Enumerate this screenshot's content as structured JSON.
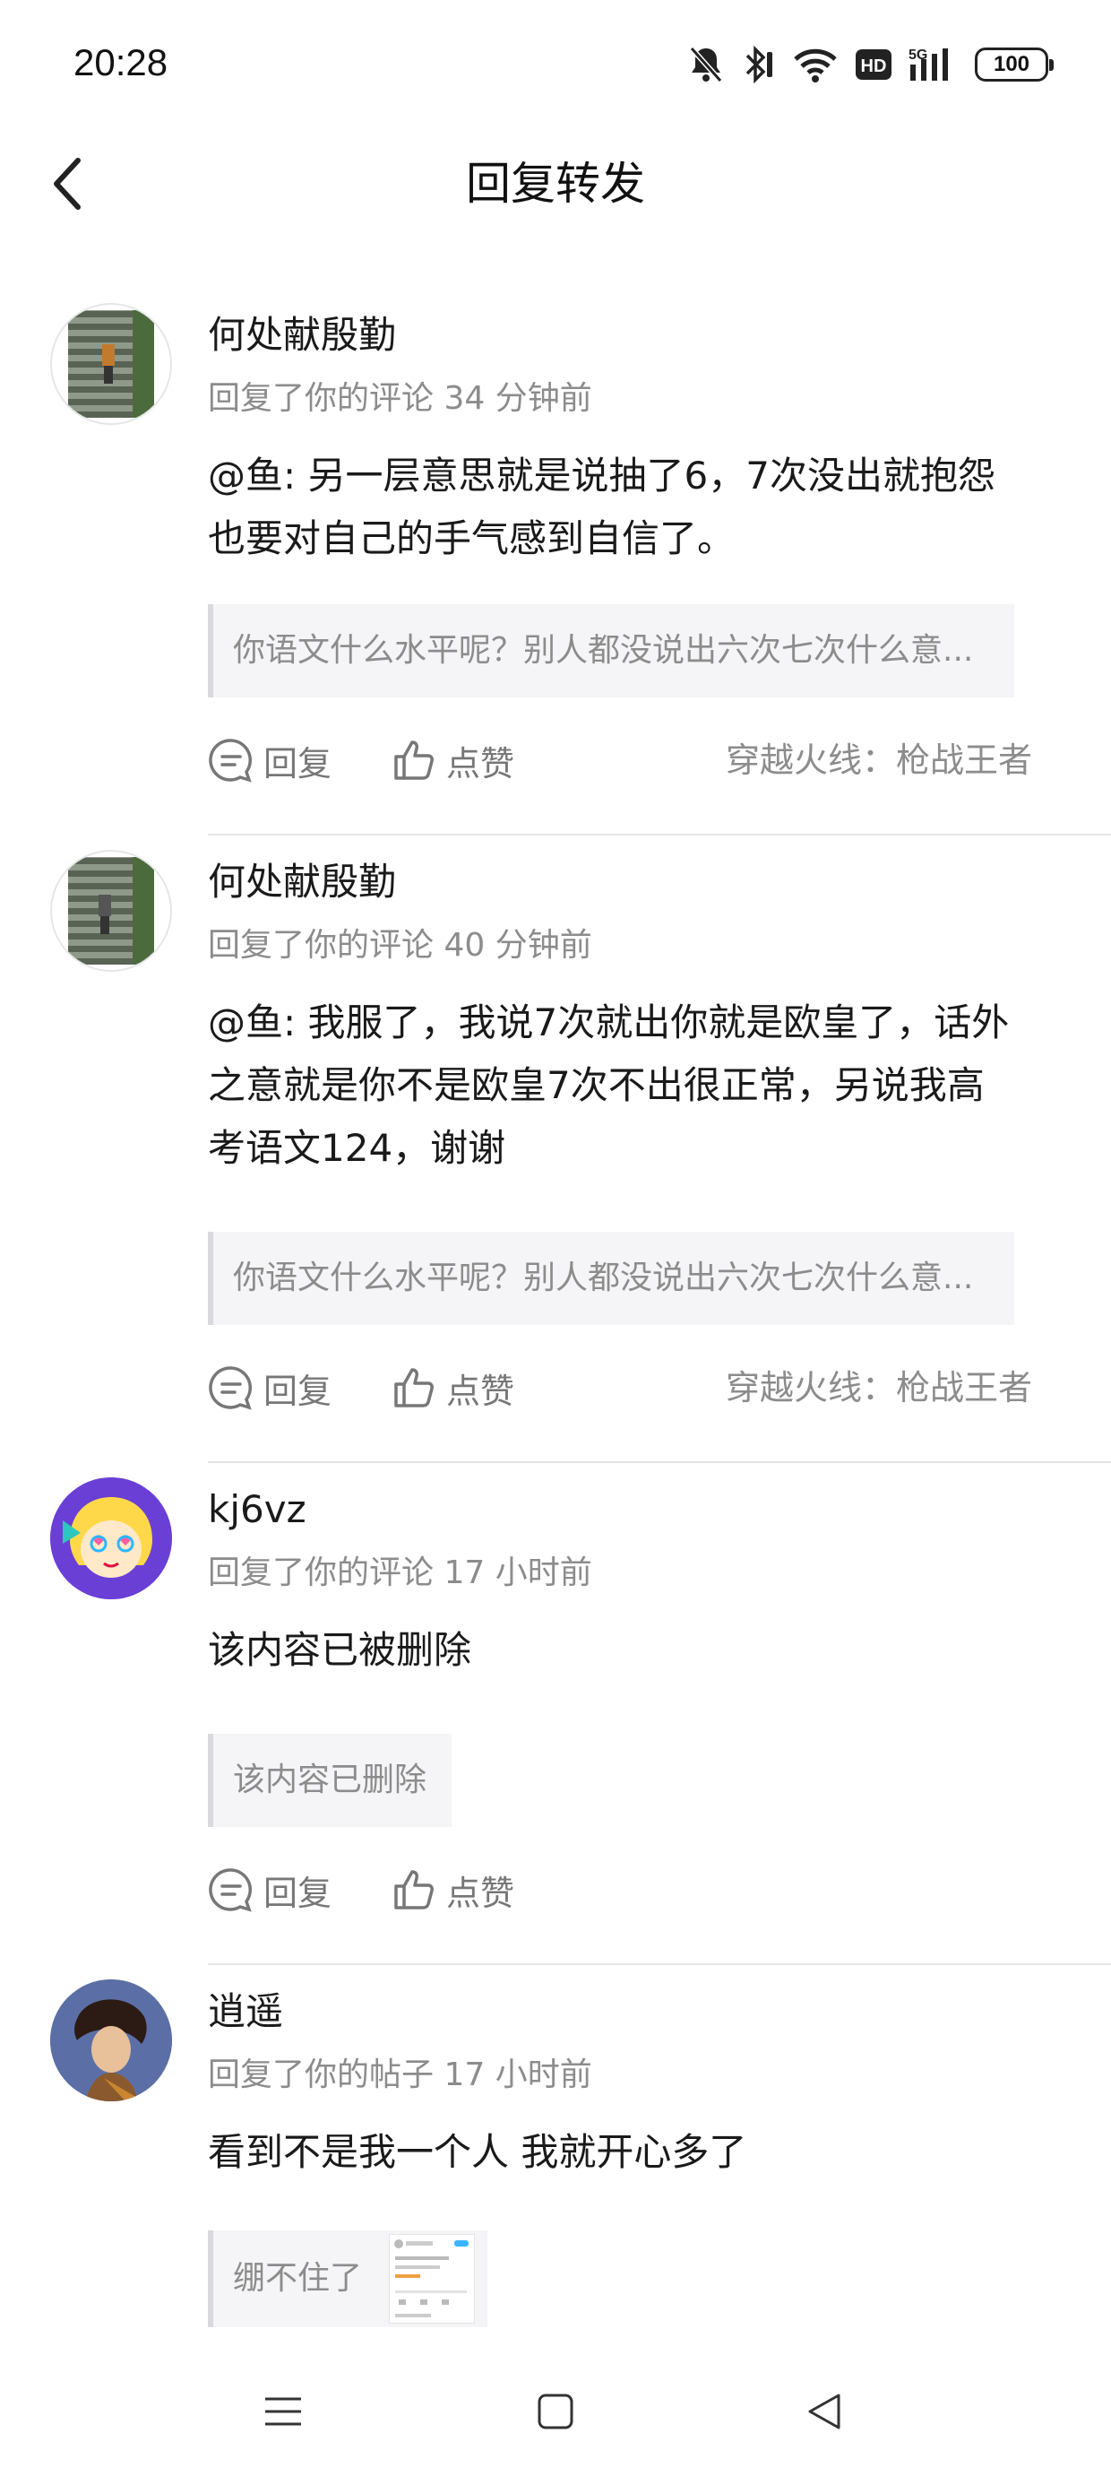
{
  "status": {
    "time": "20:28",
    "battery": "100",
    "network": "5G",
    "hd": "HD"
  },
  "header": {
    "title": "回复转发"
  },
  "items": [
    {
      "username": "何处献殷勤",
      "meta": "回复了你的评论 34 分钟前",
      "text": "@鱼: 另一层意思就是说抽了6，7次没出就抱怨也要对自己的手气感到自信了。",
      "quote": "你语文什么水平呢？别人都没说出六次七次什么意...",
      "reply_label": "回复",
      "like_label": "点赞",
      "source": "穿越火线：枪战王者"
    },
    {
      "username": "何处献殷勤",
      "meta": "回复了你的评论 40 分钟前",
      "text": "@鱼: 我服了，我说7次就出你就是欧皇了，话外之意就是你不是欧皇7次不出很正常，另说我高考语文124，谢谢",
      "quote": "你语文什么水平呢？别人都没说出六次七次什么意...",
      "reply_label": "回复",
      "like_label": "点赞",
      "source": "穿越火线：枪战王者"
    },
    {
      "username": "kj6vz",
      "meta": "回复了你的评论 17 小时前",
      "text": "该内容已被删除",
      "quote": "该内容已删除",
      "reply_label": "回复",
      "like_label": "点赞",
      "source": ""
    },
    {
      "username": "逍遥",
      "meta": "回复了你的帖子 17 小时前",
      "text": "看到不是我一个人 我就开心多了",
      "quote": "绷不住了",
      "reply_label": "",
      "like_label": "",
      "source": ""
    }
  ],
  "colors": {
    "text": "#1a1a1a",
    "muted": "#8c8c8c",
    "quote_bg": "#f5f5f7",
    "avatar_kj6vz": "#6a3fd6"
  }
}
